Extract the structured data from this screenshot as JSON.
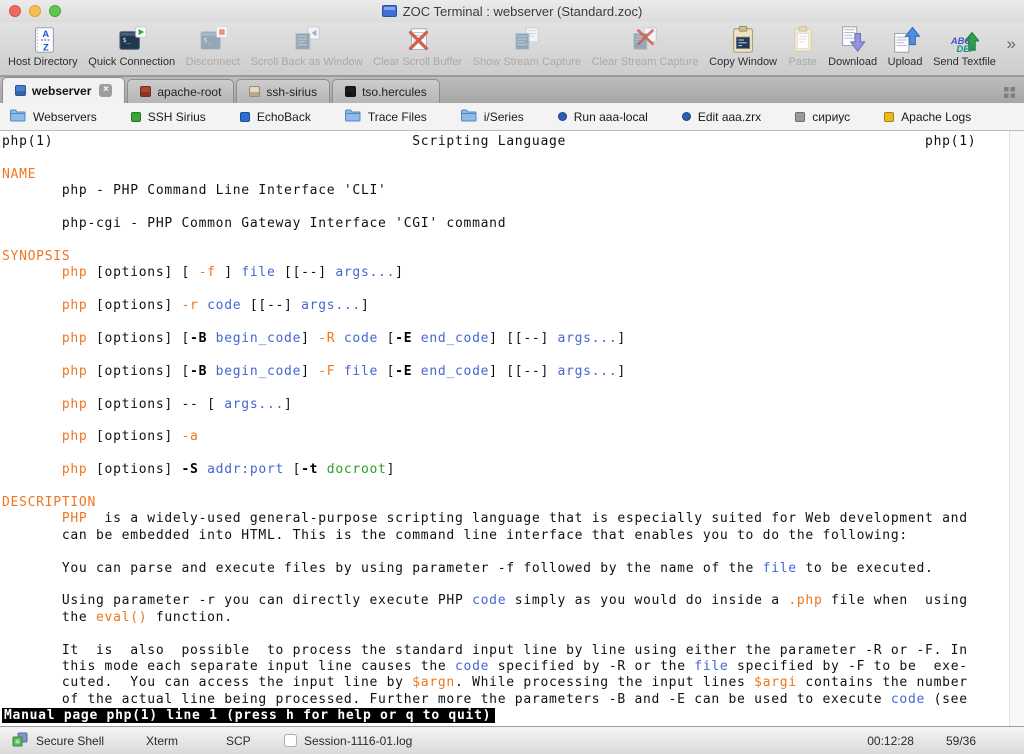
{
  "window": {
    "title": "ZOC Terminal : webserver (Standard.zoc)"
  },
  "toolbar": {
    "overflow_chevron": "»",
    "items": [
      {
        "label": "Host Directory",
        "icon": "host-directory-icon",
        "enabled": true
      },
      {
        "label": "Quick Connection",
        "icon": "quick-connection-icon",
        "enabled": true
      },
      {
        "label": "Disconnect",
        "icon": "disconnect-icon",
        "enabled": false
      },
      {
        "label": "Scroll Back as Window",
        "icon": "scrollback-window-icon",
        "enabled": false
      },
      {
        "label": "Clear Scroll Buffer",
        "icon": "clear-scroll-buffer-icon",
        "enabled": false
      },
      {
        "label": "Show Stream Capture",
        "icon": "show-stream-capture-icon",
        "enabled": false
      },
      {
        "label": "Clear Stream Capture",
        "icon": "clear-stream-capture-icon",
        "enabled": false
      },
      {
        "label": "Copy Window",
        "icon": "copy-window-icon",
        "enabled": true
      },
      {
        "label": "Paste",
        "icon": "paste-icon",
        "enabled": false
      },
      {
        "label": "Download",
        "icon": "download-icon",
        "enabled": true
      },
      {
        "label": "Upload",
        "icon": "upload-icon",
        "enabled": true
      },
      {
        "label": "Send Textfile",
        "icon": "send-textfile-icon",
        "enabled": true
      }
    ]
  },
  "tabs": {
    "close_glyph": "×",
    "items": [
      {
        "label": "webserver",
        "color": "#4a7fd6",
        "active": true,
        "closable": true
      },
      {
        "label": "apache-root",
        "color": "#b0452c",
        "active": false,
        "closable": false
      },
      {
        "label": "ssh-sirius",
        "color": "#ead9bc",
        "active": false,
        "closable": false
      },
      {
        "label": "tso.hercules",
        "color": "#1c1c1c",
        "active": false,
        "closable": false
      }
    ]
  },
  "quickbar": [
    {
      "label": "Webservers",
      "icon": "folder-icon"
    },
    {
      "label": "SSH Sirius",
      "icon": "square-icon",
      "color": "#3aa53a"
    },
    {
      "label": "EchoBack",
      "icon": "square-icon",
      "color": "#2a6fd0"
    },
    {
      "label": "Trace Files",
      "icon": "folder-icon"
    },
    {
      "label": "i/Series",
      "icon": "folder-icon"
    },
    {
      "label": "Run aaa-local",
      "icon": "circle-icon",
      "color": "#2a5fb8"
    },
    {
      "label": "Edit aaa.zrx",
      "icon": "circle-icon",
      "color": "#2a5fb8"
    },
    {
      "label": "сириус",
      "icon": "square-icon",
      "color": "#9b9b9b"
    },
    {
      "label": "Apache Logs",
      "icon": "square-icon",
      "color": "#ecb81f"
    }
  ],
  "terminal": {
    "palette": {
      "default": "#111111",
      "orange": "#ee7621",
      "blue": "#4467d4",
      "green": "#2aa02a",
      "inverse_bg": "#000000"
    },
    "lines": [
      [
        [
          "d",
          "php(1)                                          Scripting Language                                          php(1)"
        ]
      ],
      [],
      [
        [
          "o",
          "NAME"
        ]
      ],
      [
        [
          "d",
          "       php - PHP Command Line Interface 'CLI'"
        ]
      ],
      [],
      [
        [
          "d",
          "       php-cgi - PHP Common Gateway Interface 'CGI' command"
        ]
      ],
      [],
      [
        [
          "o",
          "SYNOPSIS"
        ]
      ],
      [
        [
          "d",
          "       "
        ],
        [
          "o",
          "php"
        ],
        [
          "d",
          " [options] [ "
        ],
        [
          "o",
          "-f"
        ],
        [
          "d",
          " ] "
        ],
        [
          "b",
          "file"
        ],
        [
          "d",
          " [[--] "
        ],
        [
          "b",
          "args..."
        ],
        [
          "d",
          "]"
        ]
      ],
      [],
      [
        [
          "d",
          "       "
        ],
        [
          "o",
          "php"
        ],
        [
          "d",
          " [options] "
        ],
        [
          "o",
          "-r"
        ],
        [
          "d",
          " "
        ],
        [
          "b",
          "code"
        ],
        [
          "d",
          " [[--] "
        ],
        [
          "b",
          "args..."
        ],
        [
          "d",
          "]"
        ]
      ],
      [],
      [
        [
          "d",
          "       "
        ],
        [
          "o",
          "php"
        ],
        [
          "d",
          " [options] ["
        ],
        [
          "bd",
          "-B"
        ],
        [
          "d",
          " "
        ],
        [
          "b",
          "begin_code"
        ],
        [
          "d",
          "] "
        ],
        [
          "o",
          "-R"
        ],
        [
          "d",
          " "
        ],
        [
          "b",
          "code"
        ],
        [
          "d",
          " ["
        ],
        [
          "bd",
          "-E"
        ],
        [
          "d",
          " "
        ],
        [
          "b",
          "end_code"
        ],
        [
          "d",
          "] [[--] "
        ],
        [
          "b",
          "args..."
        ],
        [
          "d",
          "]"
        ]
      ],
      [],
      [
        [
          "d",
          "       "
        ],
        [
          "o",
          "php"
        ],
        [
          "d",
          " [options] ["
        ],
        [
          "bd",
          "-B"
        ],
        [
          "d",
          " "
        ],
        [
          "b",
          "begin_code"
        ],
        [
          "d",
          "] "
        ],
        [
          "o",
          "-F"
        ],
        [
          "d",
          " "
        ],
        [
          "b",
          "file"
        ],
        [
          "d",
          " ["
        ],
        [
          "bd",
          "-E"
        ],
        [
          "d",
          " "
        ],
        [
          "b",
          "end_code"
        ],
        [
          "d",
          "] [[--] "
        ],
        [
          "b",
          "args..."
        ],
        [
          "d",
          "]"
        ]
      ],
      [],
      [
        [
          "d",
          "       "
        ],
        [
          "o",
          "php"
        ],
        [
          "d",
          " [options] -- [ "
        ],
        [
          "b",
          "args..."
        ],
        [
          "d",
          "]"
        ]
      ],
      [],
      [
        [
          "d",
          "       "
        ],
        [
          "o",
          "php"
        ],
        [
          "d",
          " [options] "
        ],
        [
          "o",
          "-a"
        ]
      ],
      [],
      [
        [
          "d",
          "       "
        ],
        [
          "o",
          "php"
        ],
        [
          "d",
          " [options] "
        ],
        [
          "bd",
          "-S"
        ],
        [
          "d",
          " "
        ],
        [
          "b",
          "addr:port"
        ],
        [
          "d",
          " ["
        ],
        [
          "bd",
          "-t"
        ],
        [
          "d",
          " "
        ],
        [
          "g",
          "docroot"
        ],
        [
          "d",
          "]"
        ]
      ],
      [],
      [
        [
          "o",
          "DESCRIPTION"
        ]
      ],
      [
        [
          "d",
          "       "
        ],
        [
          "o",
          "PHP"
        ],
        [
          "d",
          "  is a widely-used general-purpose scripting language that is especially suited for Web development and"
        ]
      ],
      [
        [
          "d",
          "       can be embedded into HTML. This is the command line interface that enables you to do the following:"
        ]
      ],
      [],
      [
        [
          "d",
          "       You can parse and execute files by using parameter -f followed by the name of the "
        ],
        [
          "b",
          "file"
        ],
        [
          "d",
          " to be executed."
        ]
      ],
      [],
      [
        [
          "d",
          "       Using parameter -r you can directly execute PHP "
        ],
        [
          "b",
          "code"
        ],
        [
          "d",
          " simply as you would do inside a "
        ],
        [
          "o",
          ".php"
        ],
        [
          "d",
          " file when  using"
        ]
      ],
      [
        [
          "d",
          "       the "
        ],
        [
          "o",
          "eval()"
        ],
        [
          "d",
          " function."
        ]
      ],
      [],
      [
        [
          "d",
          "       It  is  also  possible  to process the standard input line by line using either the parameter -R or -F. In"
        ]
      ],
      [
        [
          "d",
          "       this mode each separate input line causes the "
        ],
        [
          "b",
          "code"
        ],
        [
          "d",
          " specified by -R or the "
        ],
        [
          "b",
          "file"
        ],
        [
          "d",
          " specified by -F to be  exe-"
        ]
      ],
      [
        [
          "d",
          "       cuted.  You can access the input line by "
        ],
        [
          "o",
          "$argn"
        ],
        [
          "d",
          ". While processing the input lines "
        ],
        [
          "o",
          "$argi"
        ],
        [
          "d",
          " contains the number"
        ]
      ],
      [
        [
          "d",
          "       of the actual line being processed. Further more the parameters -B and -E can be used to execute "
        ],
        [
          "b",
          "code"
        ],
        [
          "d",
          " (see"
        ]
      ],
      [
        [
          "inv",
          "Manual page php(1) line 1 (press h for help or q to quit)"
        ]
      ]
    ]
  },
  "statusbar": {
    "protocol": "Secure Shell",
    "emulation": "Xterm",
    "transfer": "SCP",
    "log_label": "Session-1116-01.log",
    "time": "00:12:28",
    "position": "59/36"
  }
}
